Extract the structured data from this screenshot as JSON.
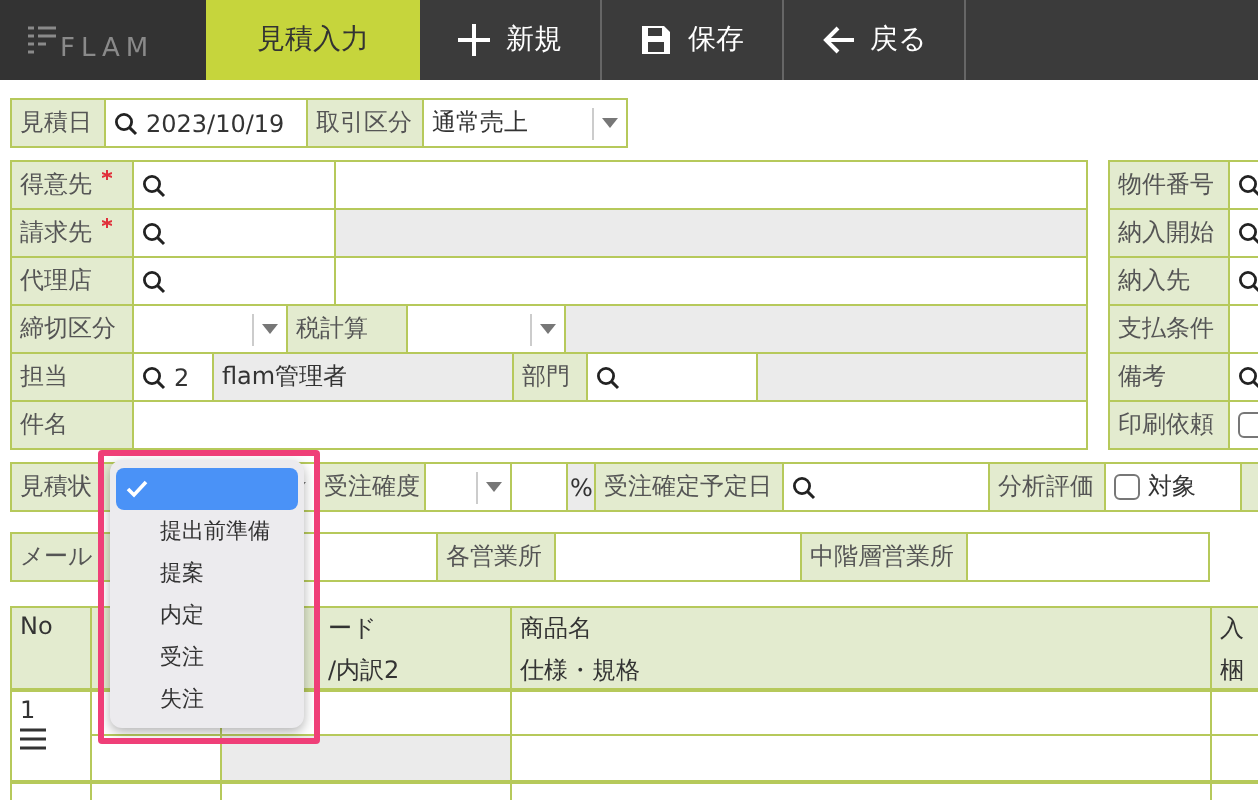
{
  "header": {
    "logo": "FLAM",
    "tabs": [
      {
        "label": "見積入力",
        "selected": true
      }
    ],
    "buttons": [
      {
        "label": "新規"
      },
      {
        "label": "保存"
      },
      {
        "label": "戻る"
      }
    ]
  },
  "date_row": [
    {
      "kind": "label",
      "text": "見積日"
    },
    {
      "kind": "search",
      "value": "2023/10/19"
    },
    {
      "kind": "label",
      "text": "取引区分"
    },
    {
      "kind": "select",
      "value": "通常売上"
    }
  ],
  "main_form": [
    [
      {
        "kind": "label",
        "text": "得意先",
        "required": true
      },
      {
        "kind": "search"
      },
      {
        "kind": "text",
        "readonly": false
      }
    ],
    [
      {
        "kind": "label",
        "text": "請求先",
        "required": true
      },
      {
        "kind": "search"
      },
      {
        "kind": "text",
        "readonly": true
      }
    ],
    [
      {
        "kind": "label",
        "text": "代理店"
      },
      {
        "kind": "search"
      },
      {
        "kind": "text",
        "readonly": false
      }
    ],
    [
      {
        "kind": "label",
        "text": "締切区分"
      },
      {
        "kind": "select"
      },
      {
        "kind": "label",
        "text": "税計算"
      },
      {
        "kind": "select"
      },
      {
        "kind": "text",
        "readonly": true
      }
    ],
    [
      {
        "kind": "label",
        "text": "担当"
      },
      {
        "kind": "search",
        "value": "2"
      },
      {
        "kind": "text",
        "readonly": true,
        "value": "flam管理者"
      },
      {
        "kind": "label",
        "text": "部門"
      },
      {
        "kind": "search"
      },
      {
        "kind": "text",
        "readonly": true
      }
    ],
    [
      {
        "kind": "label",
        "text": "件名"
      },
      {
        "kind": "text",
        "readonly": false
      }
    ]
  ],
  "side_form": [
    [
      {
        "kind": "label",
        "text": "物件番号"
      },
      {
        "kind": "search"
      }
    ],
    [
      {
        "kind": "label",
        "text": "納入開始"
      },
      {
        "kind": "search"
      }
    ],
    [
      {
        "kind": "label",
        "text": "納入先"
      },
      {
        "kind": "search"
      }
    ],
    [
      {
        "kind": "label",
        "text": "支払条件"
      },
      {
        "kind": "text",
        "readonly": false
      }
    ],
    [
      {
        "kind": "label",
        "text": "備考"
      },
      {
        "kind": "search"
      }
    ],
    [
      {
        "kind": "label",
        "text": "印刷依頼"
      },
      {
        "kind": "checkbox",
        "checked": false
      }
    ]
  ],
  "status_row": [
    {
      "kind": "label",
      "text": "見積状"
    },
    {
      "kind": "select"
    },
    {
      "kind": "label",
      "text": "受注確度"
    },
    {
      "kind": "select"
    },
    {
      "kind": "text",
      "readonly": false
    },
    {
      "kind": "unit",
      "text": "%"
    },
    {
      "kind": "label",
      "text": "受注確定予定日"
    },
    {
      "kind": "search"
    },
    {
      "kind": "label",
      "text": "分析評価"
    },
    {
      "kind": "checkbox",
      "checked": false,
      "label": "対象"
    },
    {
      "kind": "label"
    }
  ],
  "office_row": [
    {
      "kind": "label",
      "text": "メール"
    },
    {
      "kind": "text",
      "readonly": false
    },
    {
      "kind": "label",
      "text": "各営業所"
    },
    {
      "kind": "text",
      "readonly": false
    },
    {
      "kind": "label",
      "text": "中階層営業所"
    },
    {
      "kind": "text",
      "readonly": false
    }
  ],
  "table": {
    "columns": [
      [
        "No"
      ],
      [],
      [
        "ード",
        "/内訳2"
      ],
      [
        "商品名",
        "仕様・規格"
      ],
      [
        "入",
        "梱"
      ]
    ],
    "rows": [
      {
        "no": "1",
        "menu": true
      }
    ]
  },
  "dropdown": {
    "options": [
      {
        "selected": true
      },
      {
        "label": "提出前準備",
        "selected": false
      },
      {
        "label": "提案",
        "selected": false
      },
      {
        "label": "内定",
        "selected": false
      },
      {
        "label": "受注",
        "selected": false
      },
      {
        "label": "失注",
        "selected": false
      }
    ]
  }
}
